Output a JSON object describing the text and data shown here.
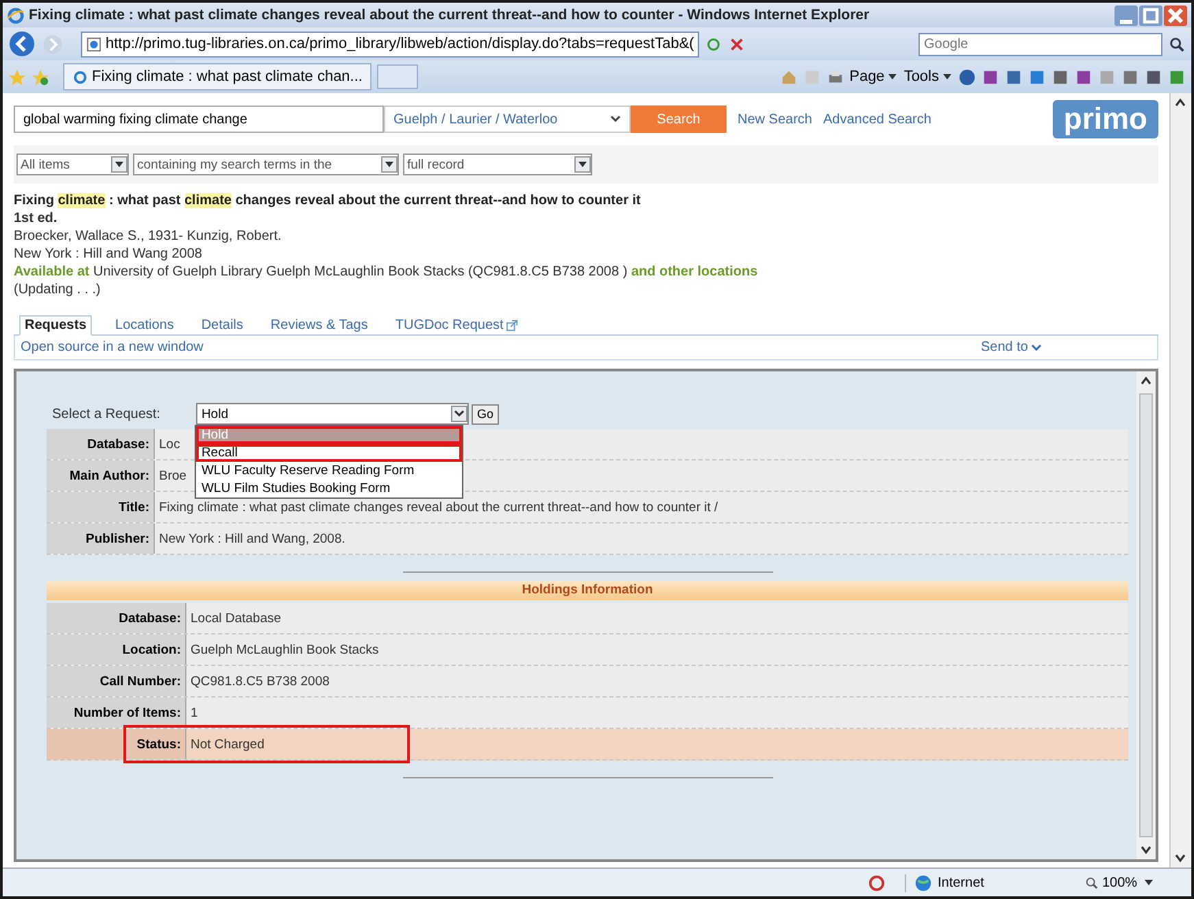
{
  "window": {
    "title": "Fixing climate : what past climate changes reveal about the current threat--and how to counter  - Windows Internet Explorer"
  },
  "browser": {
    "address": "http://primo.tug-libraries.on.ca/primo_library/libweb/action/display.do?tabs=requestTab&(",
    "search_placeholder": "Google",
    "tab_title": "Fixing climate : what past climate chan...",
    "menus": [
      "Page",
      "Tools"
    ]
  },
  "search": {
    "query": "global warming fixing climate change",
    "scope": "Guelph / Laurier / Waterloo",
    "button": "Search",
    "links": [
      "New Search",
      "Advanced Search"
    ],
    "logo": "primo"
  },
  "filters": [
    "All items",
    "containing my search terms in the",
    "full record"
  ],
  "record": {
    "title_segments": [
      {
        "text": "Fixing",
        "highlight": false
      },
      {
        "text": "climate",
        "highlight": true
      },
      {
        "text": ": what past",
        "highlight": false
      },
      {
        "text": "climate",
        "highlight": true
      },
      {
        "text": "changes reveal about the current threat--and how to counter it",
        "highlight": false
      }
    ],
    "edition": "1st ed.",
    "authors": "Broecker, Wallace S., 1931- Kunzig, Robert.",
    "publisher": "New York : Hill and Wang 2008",
    "availability_label": "Available at",
    "location": "University of Guelph Library Guelph McLaughlin Book Stacks (QC981.8.C5 B738 2008 )",
    "other_locations": "and other locations",
    "update_note": "(Updating . . .)"
  },
  "tabs": [
    {
      "label": "Requests",
      "selected": true,
      "external": false
    },
    {
      "label": "Locations",
      "selected": false,
      "external": false
    },
    {
      "label": "Details",
      "selected": false,
      "external": false
    },
    {
      "label": "Reviews & Tags",
      "selected": false,
      "external": false
    },
    {
      "label": "TUGDoc Request",
      "selected": false,
      "external": true
    }
  ],
  "open_source": "Open source in a new window",
  "send_to": "Send to",
  "request": {
    "label": "Select a Request:",
    "value": "Hold",
    "go": "Go",
    "options": [
      {
        "label": "Hold",
        "selected": true,
        "annotated": true
      },
      {
        "label": "Recall",
        "selected": false,
        "annotated": true
      },
      {
        "label": "WLU Faculty Reserve Reading Form",
        "selected": false,
        "annotated": false
      },
      {
        "label": "WLU Film Studies Booking Form",
        "selected": false,
        "annotated": false
      }
    ]
  },
  "details": [
    {
      "label": "Database:",
      "value": "Loc"
    },
    {
      "label": "Main Author:",
      "value": "Broe"
    },
    {
      "label": "Title:",
      "value": "Fixing climate :  what past climate changes reveal about the current threat--and how to counter it /"
    },
    {
      "label": "Publisher:",
      "value": "New York :  Hill and Wang,  2008."
    }
  ],
  "holdings": {
    "title": "Holdings Information",
    "rows": [
      {
        "label": "Database:",
        "value": "Local Database",
        "annotated": false
      },
      {
        "label": "Location:",
        "value": "Guelph McLaughlin Book Stacks",
        "annotated": false
      },
      {
        "label": "Call Number:",
        "value": "QC981.8.C5  B738 2008",
        "annotated": false
      },
      {
        "label": "Number of Items:",
        "value": "1",
        "annotated": false
      },
      {
        "label": "Status:",
        "value": "Not Charged",
        "annotated": true
      }
    ]
  },
  "status_bar": {
    "zone": "Internet",
    "zoom": "100%"
  }
}
